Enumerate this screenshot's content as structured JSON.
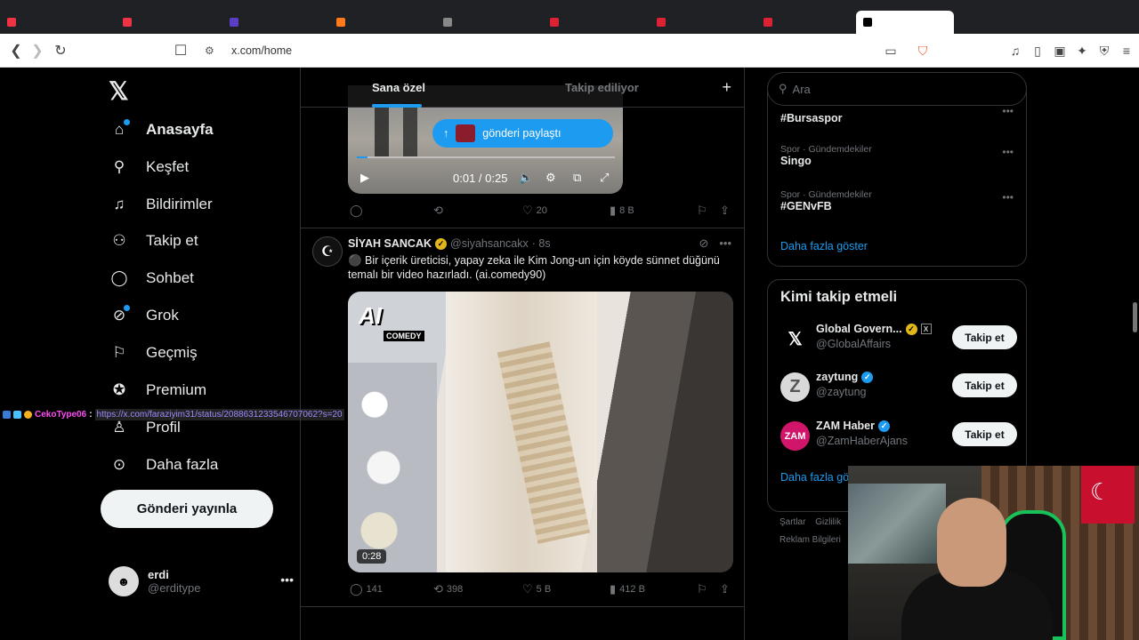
{
  "browser": {
    "url": "x.com/home",
    "tabs": [
      {
        "label": "",
        "color": "#e34"
      },
      {
        "label": "",
        "color": "#e34"
      },
      {
        "label": "",
        "color": "#5a3ec8"
      },
      {
        "label": "",
        "color": "#ff7a1a"
      },
      {
        "label": "",
        "color": "#888"
      },
      {
        "label": "",
        "color": "#d23"
      },
      {
        "label": "",
        "color": "#d23"
      },
      {
        "label": "",
        "color": "#d23"
      },
      {
        "label": "",
        "color": "#000"
      }
    ]
  },
  "leftnav": {
    "logo": "𝕏",
    "items": [
      {
        "label": "Anasayfa",
        "icon": "home-icon",
        "glyph": "⌂",
        "bold": true,
        "dot": true
      },
      {
        "label": "Keşfet",
        "icon": "search-icon",
        "glyph": "⌕"
      },
      {
        "label": "Bildirimler",
        "icon": "bell-icon",
        "glyph": "🔔"
      },
      {
        "label": "Takip et",
        "icon": "add-user-icon",
        "glyph": "👤"
      },
      {
        "label": "Sohbet",
        "icon": "chat-icon",
        "glyph": "💬"
      },
      {
        "label": "Grok",
        "icon": "grok-icon",
        "glyph": "⊘",
        "dot": true
      },
      {
        "label": "Geçmiş",
        "icon": "bookmark-icon",
        "glyph": "🔖"
      },
      {
        "label": "Premium",
        "icon": "premium-icon",
        "glyph": "✪"
      },
      {
        "label": "Profil",
        "icon": "profile-icon",
        "glyph": "👤"
      },
      {
        "label": "Daha fazla",
        "icon": "more-icon",
        "glyph": "⋯"
      }
    ],
    "post_button": "Gönderi yayınla",
    "account": {
      "name": "erdi",
      "handle": "@erditype"
    }
  },
  "main": {
    "tabs": [
      {
        "label": "Sana özel",
        "active": true
      },
      {
        "label": "Takip ediliyor",
        "active": false
      }
    ],
    "first_post": {
      "share_pill": "gönderi paylaştı",
      "time": "0:01 / 0:25",
      "progress": 0.04,
      "replies": "",
      "reposts": "",
      "likes": "20",
      "views": "8 B"
    },
    "tweet": {
      "name": "SİYAH SANCAK",
      "handle": "@siyahsancakx",
      "time": "· 8s",
      "text": "⚫ Bir içerik üreticisi, yapay zeka ile Kim Jong-un için köyde sünnet düğünü temalı bir video hazırladı. (ai.comedy90)",
      "media_logo": "AI",
      "media_logo_sub": "COMEDY",
      "duration": "0:28",
      "replies": "141",
      "reposts": "398",
      "likes": "5 B",
      "views": "412 B"
    }
  },
  "right": {
    "search_placeholder": "Ara",
    "trends": [
      {
        "context": "",
        "name": "#Bursaspor"
      },
      {
        "context": "Spor · Gündemdekiler",
        "name": "Singo"
      },
      {
        "context": "Spor · Gündemdekiler",
        "name": "#GENvFB"
      }
    ],
    "trends_show_more": "Daha fazla göster",
    "who_to_follow": {
      "title": "Kimi takip etmeli",
      "items": [
        {
          "name": "Global Govern...",
          "handle": "@GlobalAffairs",
          "avatar": "𝕏",
          "badge": "gold",
          "follow": "Takip et"
        },
        {
          "name": "zaytung",
          "handle": "@zaytung",
          "avatar": "Z",
          "badge": "blue",
          "follow": "Takip et"
        },
        {
          "name": "ZAM Haber",
          "handle": "@ZamHaberAjans",
          "avatar": "ZAM",
          "badge": "blue",
          "follow": "Takip et"
        }
      ],
      "show_more": "Daha fazla göst"
    },
    "footer": [
      "Şartlar",
      "Gizlilik",
      "Reklam Bilgileri"
    ]
  },
  "overlay": {
    "chat_user": "CekoType06",
    "chat_sep": ":",
    "chat_link": "https://x.com/faraziyim31/status/2088631233546707062?s=20"
  },
  "colors": {
    "accent": "#1d9bf0",
    "gold_badge": "#e2b719",
    "chair": "#19c15a"
  }
}
